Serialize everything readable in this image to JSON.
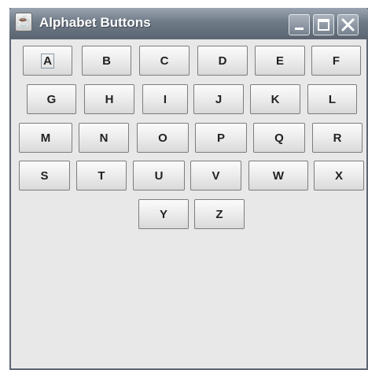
{
  "window": {
    "title": "Alphabet Buttons",
    "app_icon": "java-cup-icon",
    "controls": [
      "minimize-icon",
      "maximize-icon",
      "close-icon"
    ]
  },
  "buttons": [
    [
      "A",
      "B",
      "C",
      "D",
      "E",
      "F"
    ],
    [
      "G",
      "H",
      "I",
      "J",
      "K",
      "L"
    ],
    [
      "M",
      "N",
      "O",
      "P",
      "Q",
      "R"
    ],
    [
      "S",
      "T",
      "U",
      "V",
      "W",
      "X"
    ],
    [
      "Y",
      "Z"
    ]
  ],
  "focused_button": "A",
  "colors": {
    "titlebar": "#6f7a87",
    "content_bg": "#e8e8e8",
    "button_border": "#7d7d7d"
  }
}
